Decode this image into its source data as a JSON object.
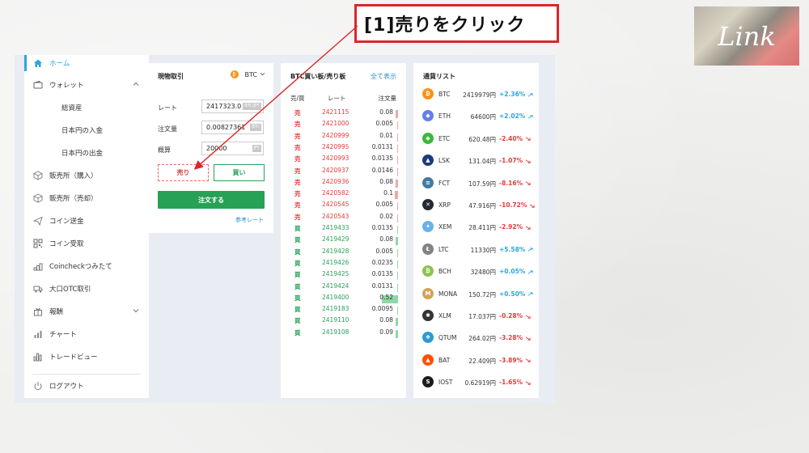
{
  "callout": {
    "text": "[1]売りをクリック"
  },
  "logo": {
    "text": "Link"
  },
  "sidebar": {
    "items": [
      {
        "label": "ホーム",
        "icon": "home-icon",
        "active": true
      },
      {
        "label": "ウォレット",
        "icon": "wallet-icon",
        "expanded": true
      },
      {
        "label": "総資産",
        "sub": true
      },
      {
        "label": "日本円の入金",
        "sub": true
      },
      {
        "label": "日本円の出金",
        "sub": true
      },
      {
        "label": "販売所（購入）",
        "icon": "cube-icon"
      },
      {
        "label": "販売所（売却）",
        "icon": "cube-icon"
      },
      {
        "label": "コイン送金",
        "icon": "send-icon"
      },
      {
        "label": "コイン受取",
        "icon": "qr-icon"
      },
      {
        "label": "Coincheckつみたて",
        "icon": "coins-icon"
      },
      {
        "label": "大口OTC取引",
        "icon": "truck-icon"
      },
      {
        "label": "報酬",
        "icon": "gift-icon",
        "expandable": true
      },
      {
        "label": "チャート",
        "icon": "chart-icon"
      },
      {
        "label": "トレードビュー",
        "icon": "tradeview-icon"
      }
    ],
    "logout": "ログアウト"
  },
  "trade": {
    "title": "現物取引",
    "pair": "BTC",
    "rate_label": "レート",
    "rate_value": "2417323.0",
    "rate_unit": "BTC/JPY",
    "qty_label": "注文量",
    "qty_value": "0.00827361",
    "qty_unit": "BTC",
    "est_label": "概算",
    "est_value": "20000",
    "est_unit": "JPY",
    "sell_label": "売り",
    "buy_label": "買い",
    "order_label": "注文する",
    "ref_label": "参考レート"
  },
  "board": {
    "title": "BTC買い板/売り板",
    "show_all": "全て表示",
    "col_side": "売/買",
    "col_rate": "レート",
    "col_amount": "注文量",
    "rows": [
      {
        "side": "売",
        "rate": "2421115",
        "amount": "0.08",
        "depth": 0.06
      },
      {
        "side": "売",
        "rate": "2421000",
        "amount": "0.005",
        "depth": 0.0
      },
      {
        "side": "売",
        "rate": "2420999",
        "amount": "0.01",
        "depth": 0.01
      },
      {
        "side": "売",
        "rate": "2420995",
        "amount": "0.0131",
        "depth": 0.01
      },
      {
        "side": "売",
        "rate": "2420993",
        "amount": "0.0135",
        "depth": 0.01
      },
      {
        "side": "売",
        "rate": "2420937",
        "amount": "0.0146",
        "depth": 0.01
      },
      {
        "side": "売",
        "rate": "2420936",
        "amount": "0.08",
        "depth": 0.06
      },
      {
        "side": "売",
        "rate": "2420582",
        "amount": "0.1",
        "depth": 0.08
      },
      {
        "side": "売",
        "rate": "2420545",
        "amount": "0.005",
        "depth": 0.0
      },
      {
        "side": "売",
        "rate": "2420543",
        "amount": "0.02",
        "depth": 0.02
      },
      {
        "side": "買",
        "rate": "2419433",
        "amount": "0.0135",
        "depth": 0.01
      },
      {
        "side": "買",
        "rate": "2419429",
        "amount": "0.08",
        "depth": 0.06
      },
      {
        "side": "買",
        "rate": "2419428",
        "amount": "0.005",
        "depth": 0.0
      },
      {
        "side": "買",
        "rate": "2419426",
        "amount": "0.0235",
        "depth": 0.02
      },
      {
        "side": "買",
        "rate": "2419425",
        "amount": "0.0135",
        "depth": 0.01
      },
      {
        "side": "買",
        "rate": "2419424",
        "amount": "0.0131",
        "depth": 0.01
      },
      {
        "side": "買",
        "rate": "2419400",
        "amount": "0.52",
        "depth": 0.4
      },
      {
        "side": "買",
        "rate": "2419183",
        "amount": "0.0095",
        "depth": 0.01
      },
      {
        "side": "買",
        "rate": "2419110",
        "amount": "0.08",
        "depth": 0.06
      },
      {
        "side": "買",
        "rate": "2419108",
        "amount": "0.09",
        "depth": 0.07
      }
    ]
  },
  "currency_list": {
    "title": "通貨リスト",
    "rows": [
      {
        "sym": "BTC",
        "price": "2419979円",
        "change": "+2.36%",
        "dir": "up",
        "icon": "btc-icon",
        "color": "#f7931a",
        "glyph": "₿"
      },
      {
        "sym": "ETH",
        "price": "64600円",
        "change": "+2.02%",
        "dir": "up",
        "icon": "eth-icon",
        "color": "#627eea",
        "glyph": "◆"
      },
      {
        "sym": "ETC",
        "price": "620.48円",
        "change": "-2.40%",
        "dir": "down",
        "icon": "etc-icon",
        "color": "#3ab83a",
        "glyph": "◆"
      },
      {
        "sym": "LSK",
        "price": "131.04円",
        "change": "-1.07%",
        "dir": "down",
        "icon": "lsk-icon",
        "color": "#1a3c78",
        "glyph": "▲"
      },
      {
        "sym": "FCT",
        "price": "107.59円",
        "change": "-8.16%",
        "dir": "down",
        "icon": "fct-icon",
        "color": "#417ba4",
        "glyph": "≡"
      },
      {
        "sym": "XRP",
        "price": "47.916円",
        "change": "-10.72%",
        "dir": "down",
        "icon": "xrp-icon",
        "color": "#23292f",
        "glyph": "✕"
      },
      {
        "sym": "XEM",
        "price": "28.411円",
        "change": "-2.92%",
        "dir": "down",
        "icon": "xem-icon",
        "color": "#67b2e8",
        "glyph": "✦"
      },
      {
        "sym": "LTC",
        "price": "11330円",
        "change": "+5.58%",
        "dir": "up",
        "icon": "ltc-icon",
        "color": "#838383",
        "glyph": "Ł"
      },
      {
        "sym": "BCH",
        "price": "32480円",
        "change": "+0.05%",
        "dir": "up",
        "icon": "bch-icon",
        "color": "#8dc351",
        "glyph": "₿"
      },
      {
        "sym": "MONA",
        "price": "150.72円",
        "change": "+0.50%",
        "dir": "up",
        "icon": "mona-icon",
        "color": "#d4a35b",
        "glyph": "M"
      },
      {
        "sym": "XLM",
        "price": "17.037円",
        "change": "-0.28%",
        "dir": "down",
        "icon": "xlm-icon",
        "color": "#333333",
        "glyph": "✱"
      },
      {
        "sym": "QTUM",
        "price": "264.02円",
        "change": "-3.28%",
        "dir": "down",
        "icon": "qtum-icon",
        "color": "#2e9ad0",
        "glyph": "❖"
      },
      {
        "sym": "BAT",
        "price": "22.409円",
        "change": "-3.89%",
        "dir": "down",
        "icon": "bat-icon",
        "color": "#ff5000",
        "glyph": "▲"
      },
      {
        "sym": "IOST",
        "price": "0.62919円",
        "change": "-1.65%",
        "dir": "down",
        "icon": "iost-icon",
        "color": "#1c1c1c",
        "glyph": "S"
      }
    ]
  },
  "colors": {
    "accent": "#2aa7d9",
    "sell": "#e23b3b",
    "buy": "#27a155",
    "callout_border": "#d82828"
  }
}
